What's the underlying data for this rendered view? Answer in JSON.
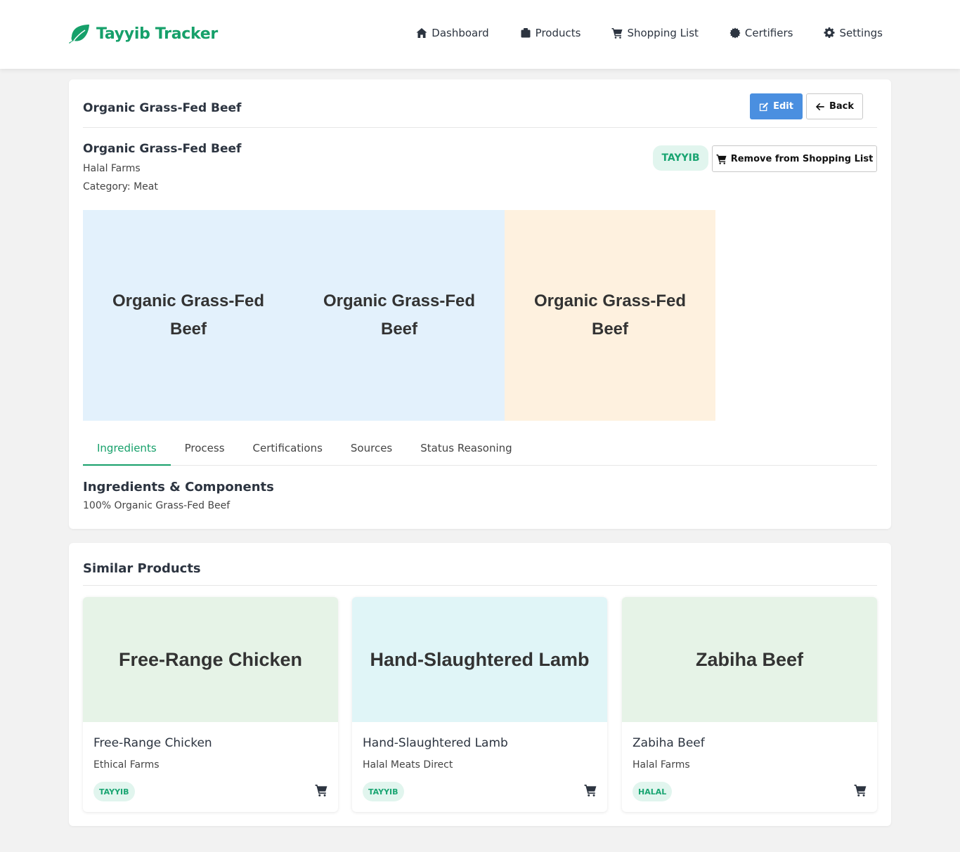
{
  "brand": {
    "name": "Tayyib Tracker",
    "accent": "#16a06a"
  },
  "nav": [
    {
      "label": "Dashboard",
      "icon": "home-icon"
    },
    {
      "label": "Products",
      "icon": "box-icon"
    },
    {
      "label": "Shopping List",
      "icon": "cart-icon"
    },
    {
      "label": "Certifiers",
      "icon": "certificate-icon"
    },
    {
      "label": "Settings",
      "icon": "gear-icon"
    }
  ],
  "product_card": {
    "title": "Organic Grass-Fed Beef",
    "edit_label": "Edit",
    "back_label": "Back",
    "name": "Organic Grass-Fed Beef",
    "brand": "Halal Farms",
    "category": "Category: Meat",
    "status_badge": "TAYYIB",
    "remove_label": "Remove from Shopping List",
    "gallery": [
      {
        "text": "Organic Grass-Fed Beef",
        "color": "#e3f1fc"
      },
      {
        "text": "Organic Grass-Fed Beef",
        "color": "#e3f1fc"
      },
      {
        "text": "Organic Grass-Fed Beef",
        "color": "#fef1df"
      }
    ],
    "tabs": [
      "Ingredients",
      "Process",
      "Certifications",
      "Sources",
      "Status Reasoning"
    ],
    "active_tab": "Ingredients",
    "section_heading": "Ingredients & Components",
    "section_text": "100% Organic Grass-Fed Beef"
  },
  "similar": {
    "title": "Similar Products",
    "items": [
      {
        "image_text": "Free-Range Chicken",
        "name": "Free-Range Chicken",
        "brand": "Ethical Farms",
        "badge": "TAYYIB",
        "color": "#e6f3e7"
      },
      {
        "image_text": "Hand-Slaughtered Lamb",
        "name": "Hand-Slaughtered Lamb",
        "brand": "Halal Meats Direct",
        "badge": "TAYYIB",
        "color": "#e0f5f7"
      },
      {
        "image_text": "Zabiha Beef",
        "name": "Zabiha Beef",
        "brand": "Halal Farms",
        "badge": "HALAL",
        "color": "#e6f3e7"
      }
    ]
  }
}
